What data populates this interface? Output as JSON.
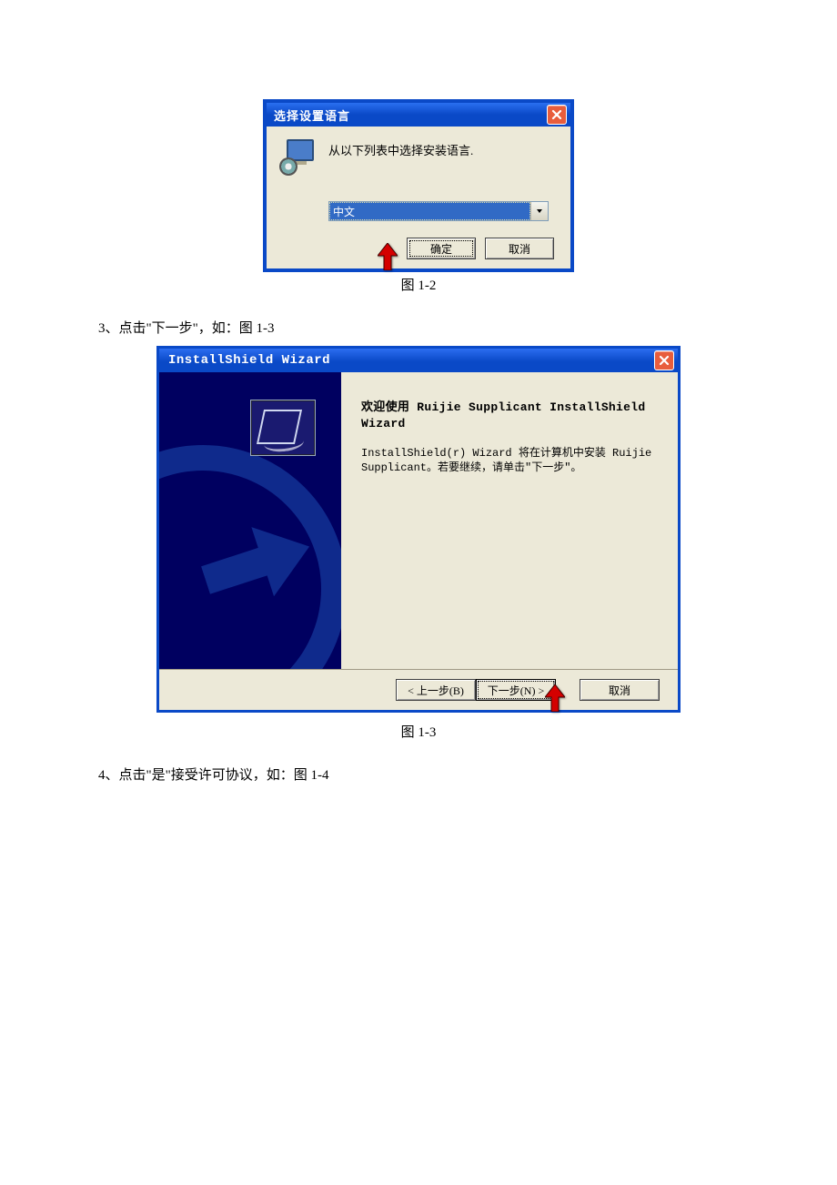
{
  "dlg1": {
    "title": "选择设置语言",
    "message": "从以下列表中选择安装语言.",
    "select_value": "中文",
    "ok_label": "确定",
    "cancel_label": "取消"
  },
  "caption1": "图 1-2",
  "step3": "3、点击\"下一步\"，如：图 1-3",
  "dlg2": {
    "title": "InstallShield Wizard",
    "heading": "欢迎使用 Ruijie Supplicant InstallShield Wizard",
    "body": "InstallShield(r) Wizard 将在计算机中安装 Ruijie Supplicant。若要继续，请单击\"下一步\"。",
    "back_label": "< 上一步(B)",
    "next_label": "下一步(N) >",
    "cancel_label": "取消"
  },
  "caption2": "图 1-3",
  "step4": "4、点击\"是\"接受许可协议，如：图 1-4"
}
